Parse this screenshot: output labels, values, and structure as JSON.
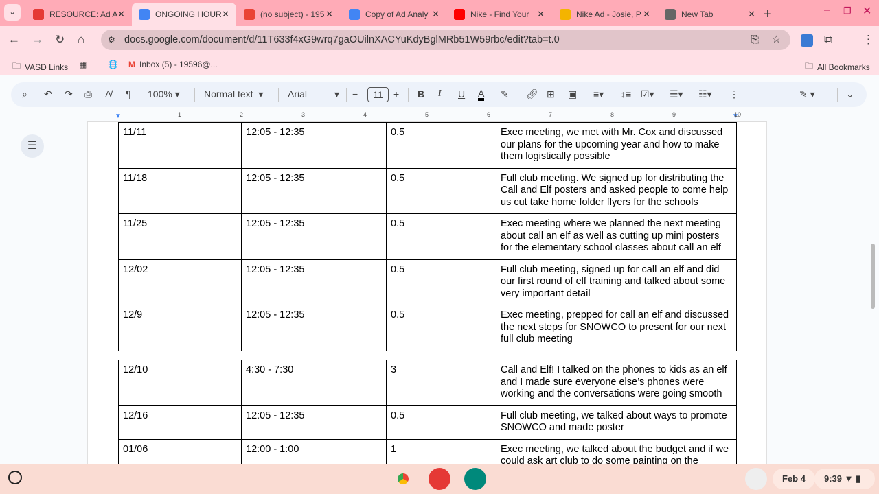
{
  "tabs": [
    {
      "title": "RESOURCE: Ad A",
      "icon": "resource-icon",
      "color": "#e53935"
    },
    {
      "title": "ONGOING HOURS",
      "icon": "docs-icon",
      "color": "#4285f4",
      "active": true
    },
    {
      "title": "(no subject) - 195",
      "icon": "gmail-icon",
      "color": "#ea4335"
    },
    {
      "title": "Copy of Ad Analy",
      "icon": "docs-icon",
      "color": "#4285f4"
    },
    {
      "title": "Nike - Find Your",
      "icon": "youtube-icon",
      "color": "#ff0000"
    },
    {
      "title": "Nike Ad - Josie, P",
      "icon": "slides-icon",
      "color": "#f4b400"
    },
    {
      "title": "New Tab",
      "icon": "chrome-icon",
      "color": "#666"
    }
  ],
  "url": "docs.google.com/document/d/11T633f4xG9wrq7gaOUilnXACYuKdyBglMRb51W59rbc/edit?tab=t.0",
  "bookmarks": {
    "vasd": "VASD Links",
    "inbox": "Inbox (5) - 19596@...",
    "all": "All Bookmarks"
  },
  "toolbar": {
    "zoom": "100%",
    "style": "Normal text",
    "font": "Arial",
    "size": "11"
  },
  "ruler": [
    "1",
    "2",
    "3",
    "4",
    "5",
    "6",
    "7",
    "8",
    "9",
    "10"
  ],
  "table1": [
    [
      "11/11",
      "12:05 - 12:35",
      "0.5",
      "Exec meeting, we met with Mr. Cox and discussed our plans for the upcoming year and how to make them logistically possible"
    ],
    [
      "11/18",
      "12:05 - 12:35",
      "0.5",
      "Full club meeting. We signed up for distributing the Call and Elf posters and asked people to come help us cut take home folder flyers for the schools"
    ],
    [
      "11/25",
      "12:05 - 12:35",
      "0.5",
      "Exec meeting where we planned the next meeting about call an elf as well as cutting up mini posters for the elementary school classes about call an elf"
    ],
    [
      "12/02",
      "12:05 - 12:35",
      "0.5",
      "Full club meeting, signed up for call an elf and did our first round of elf training and talked about some very important detail"
    ],
    [
      "12/9",
      "12:05 - 12:35",
      "0.5",
      "Exec meeting, prepped for call an elf and discussed the next steps for SNOWCO to present for our next full club meeting"
    ]
  ],
  "table2": [
    [
      "12/10",
      "4:30 - 7:30",
      "3",
      "Call and Elf! I talked on the phones to kids as an elf and I made sure everyone else’s phones were working and the conversations were going smooth"
    ],
    [
      "12/16",
      "12:05 - 12:35",
      "0.5",
      "Full club meeting, we talked about ways to promote SNOWCO and made poster"
    ],
    [
      "01/06",
      "12:00 - 1:00",
      "1",
      "Exec meeting, we talked about the budget and if we could ask art club to do some painting on the"
    ]
  ],
  "shelf": {
    "date": "Feb 4",
    "time": "9:39"
  }
}
